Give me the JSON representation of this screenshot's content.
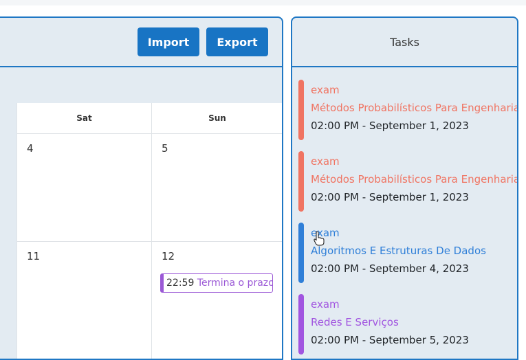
{
  "toolbar": {
    "import_label": "Import",
    "export_label": "Export"
  },
  "calendar": {
    "days_of_week": [
      "Sat",
      "Sun"
    ],
    "weeks": [
      {
        "sat": "4",
        "sun": "5"
      },
      {
        "sat": "11",
        "sun": "12"
      }
    ],
    "event": {
      "time": "22:59",
      "title": "Termina o prazo",
      "color": "#9b59d6"
    }
  },
  "tasks": {
    "title": "Tasks",
    "items": [
      {
        "type": "exam",
        "title": "Métodos Probabilísticos Para Engenharia",
        "date": "02:00 PM - September 1, 2023",
        "color": "#f07462"
      },
      {
        "type": "exam",
        "title": "Métodos Probabilísticos Para Engenharia",
        "date": "02:00 PM - September 1, 2023",
        "color": "#f07462"
      },
      {
        "type": "exam",
        "title": "Algoritmos E Estruturas De Dados",
        "date": "02:00 PM - September 4, 2023",
        "color": "#2f7fd8"
      },
      {
        "type": "exam",
        "title": "Redes E Serviços",
        "date": "02:00 PM - September 5, 2023",
        "color": "#a155e0"
      }
    ]
  },
  "colors": {
    "accent": "#1f77c4",
    "button": "#1874c4",
    "panel_bg": "#e3ebf2"
  }
}
